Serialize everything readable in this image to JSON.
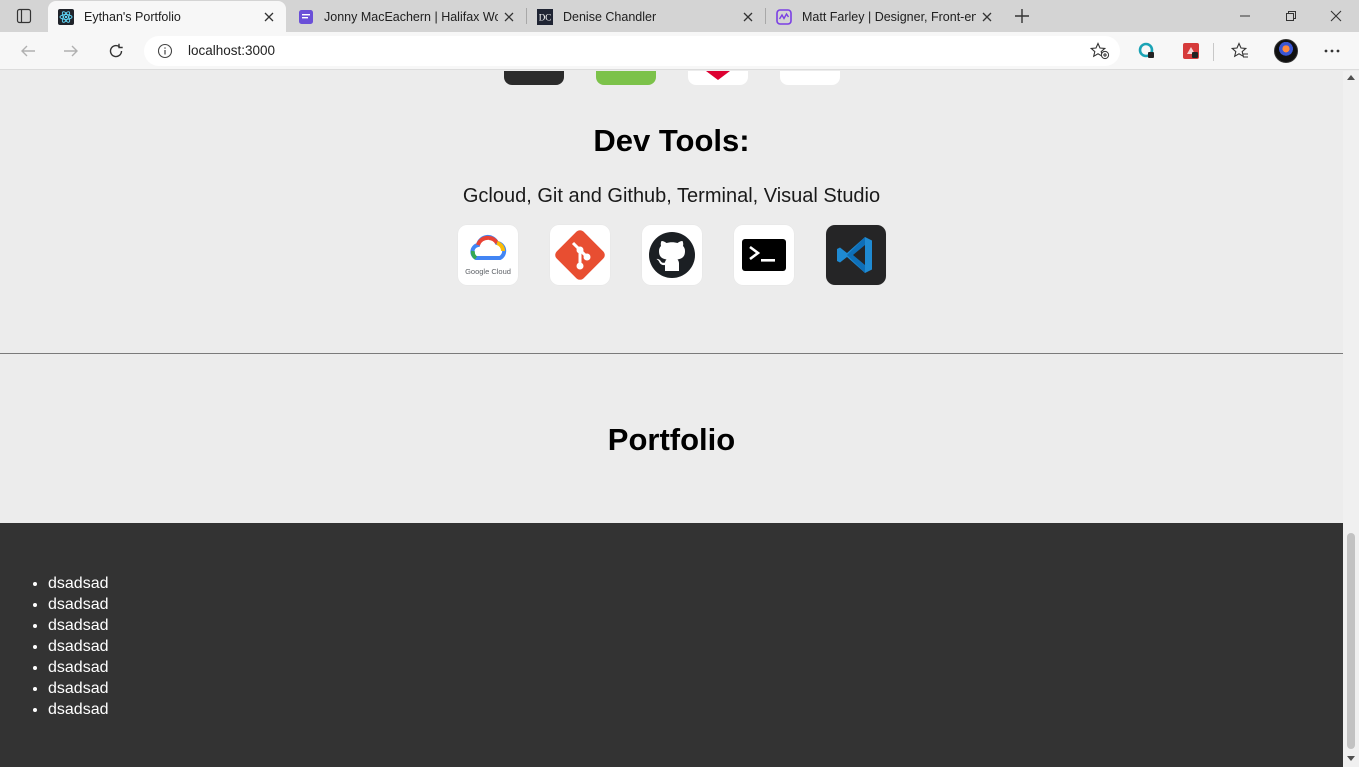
{
  "browser": {
    "tabs": [
      {
        "title": "Eythan's Portfolio",
        "active": true,
        "icon": "react-icon"
      },
      {
        "title": "Jonny MacEachern | Halifax Word",
        "active": false,
        "icon": "document-icon"
      },
      {
        "title": "Denise Chandler",
        "active": false,
        "icon": "dc-icon"
      },
      {
        "title": "Matt Farley | Designer, Front-end",
        "active": false,
        "icon": "pulse-icon"
      }
    ],
    "address": "localhost:3000"
  },
  "page": {
    "dev_tools": {
      "heading": "Dev Tools:",
      "description": "Gcloud, Git and Github, Terminal, Visual Studio",
      "icons": [
        "google-cloud-icon",
        "git-icon",
        "github-icon",
        "terminal-icon",
        "vscode-icon"
      ],
      "google_cloud_caption": "Google Cloud"
    },
    "portfolio": {
      "heading": "Portfolio"
    },
    "list": [
      "dsadsad",
      "dsadsad",
      "dsadsad",
      "dsadsad",
      "dsadsad",
      "dsadsad",
      "dsadsad"
    ]
  },
  "colors": {
    "page_bg": "#ececec",
    "dark_section_bg": "#333333",
    "tabbar_bg": "#d4d4d4",
    "toolbar_bg": "#f7f7f7",
    "git_red": "#e84e31",
    "vscode_blue": "#1f8ad2"
  }
}
